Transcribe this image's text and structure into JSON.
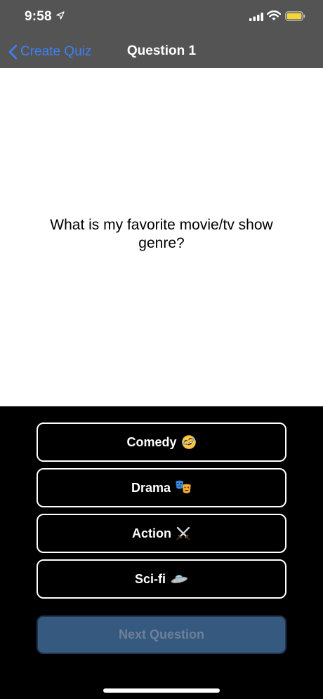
{
  "status_bar": {
    "time": "9:58"
  },
  "nav": {
    "back_label": "Create Quiz",
    "title": "Question 1"
  },
  "question": {
    "text": "What is my favorite movie/tv show genre?"
  },
  "answers": [
    {
      "label": "Comedy",
      "icon": "rolling-laughing-emoji"
    },
    {
      "label": "Drama",
      "icon": "performing-arts-emoji"
    },
    {
      "label": "Action",
      "icon": "crossed-swords-emoji"
    },
    {
      "label": "Sci-fi",
      "icon": "flying-saucer-emoji"
    }
  ],
  "footer": {
    "next_label": "Next Question"
  },
  "colors": {
    "nav_background": "#545454",
    "link_blue": "#3b82f6",
    "next_button": "#36597f",
    "battery": "#f5d43b"
  }
}
